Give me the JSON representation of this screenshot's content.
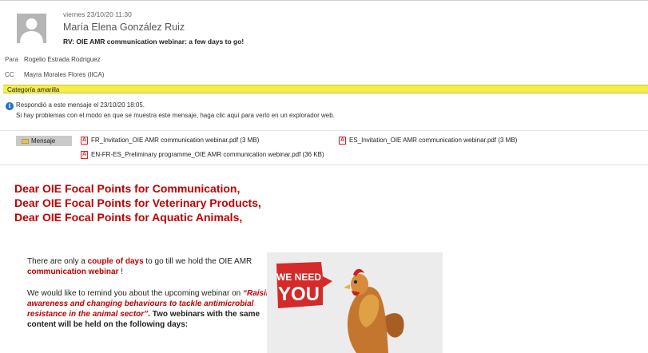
{
  "header": {
    "date": "viernes 23/10/20 11:30",
    "sender": "María Elena González Ruiz",
    "subject": "RV: OIE AMR communication webinar: a few days to go!",
    "to_label": "Para",
    "to_value": "Rogelio Estrada Rodriguez",
    "cc_label": "CC",
    "cc_value": "Mayra Morales Flores (IICA)"
  },
  "category": {
    "label": "Categoría amarilla",
    "color": "#f5ee48"
  },
  "info": {
    "line1": "Respondió a este mensaje el 23/10/20 18:05.",
    "line2": "Si hay problemas con el modo en que se muestra este mensaje, haga clic aquí para verlo en un explorador web."
  },
  "attachments": {
    "message_tab": "Mensaje",
    "items": [
      "FR_Invitation_OIE AMR communication webinar.pdf (3 MB)",
      "ES_Invitation_OIE AMR communication webinar.pdf (3 MB)",
      "EN-FR-ES_Preliminary programme_OIE AMR communication webinar.pdf (36 KB)"
    ]
  },
  "body": {
    "greetings": [
      "Dear OIE Focal Points for Communication,",
      "Dear OIE Focal Points for Veterinary Products,",
      "Dear OIE Focal Points for Aquatic Animals,"
    ],
    "p1_a": "There are only a ",
    "p1_b": "couple of days",
    "p1_c": " to go till we hold the OIE AMR ",
    "p1_d": "communication webinar",
    "p1_e": " !",
    "p2_a": "We would like to remind you about the upcoming webinar on ",
    "p2_b": "“Raising awareness and changing behaviours to tackle antimicrobial resistance in the animal sector”",
    "p2_c": ".  Two webinars with the same content will be held on the following days:"
  },
  "promo": {
    "line1": "WE NEED",
    "line2": "YOU",
    "badge_color": "#d42a2a"
  }
}
